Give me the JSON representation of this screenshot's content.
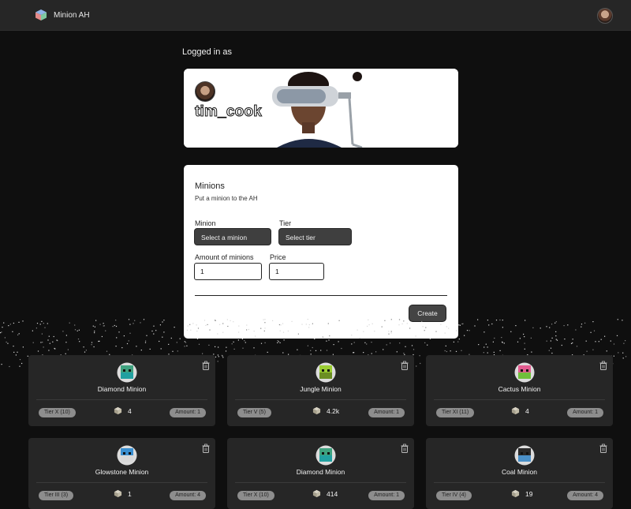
{
  "navbar": {
    "brand": "Minion AH",
    "logo_icon": "cube-logo-icon",
    "avatar_icon": "user-avatar-icon"
  },
  "profile": {
    "logged_in_label": "Logged in as",
    "username": "tim_cook"
  },
  "form": {
    "title": "Minions",
    "subtitle": "Put a minion to the AH",
    "minion_label": "Minion",
    "minion_placeholder": "Select a minion",
    "tier_label": "Tier",
    "tier_placeholder": "Select tier",
    "amount_label": "Amount of minions",
    "amount_value": "1",
    "price_label": "Price",
    "price_value": "1",
    "create_label": "Create"
  },
  "colors": {
    "background": "#0f0f0f",
    "card": "#262626",
    "pill": "#8d8d8d",
    "button": "#444444"
  },
  "minions": [
    {
      "name": "Diamond Minion",
      "tier": "Tier X (10)",
      "price": "4",
      "amount": "Amount: 1",
      "icon": "diamond-minion-icon",
      "top": "#3fa27f",
      "base": "#21a0a0"
    },
    {
      "name": "Jungle Minion",
      "tier": "Tier V (5)",
      "price": "4.2k",
      "amount": "Amount: 1",
      "icon": "jungle-minion-icon",
      "top": "#9acd32",
      "base": "#6b8e23"
    },
    {
      "name": "Cactus Minion",
      "tier": "Tier XI (11)",
      "price": "4",
      "amount": "Amount: 1",
      "icon": "cactus-minion-icon",
      "top": "#e25b8f",
      "base": "#6fbf3a"
    },
    {
      "name": "Glowstone Minion",
      "tier": "Tier III (3)",
      "price": "1",
      "amount": "Amount: 4",
      "icon": "glowstone-minion-icon",
      "top": "#3a8fd0",
      "base": "#d8d8d8"
    },
    {
      "name": "Diamond Minion",
      "tier": "Tier X (10)",
      "price": "414",
      "amount": "Amount: 1",
      "icon": "diamond-minion-icon",
      "top": "#3fa27f",
      "base": "#21a0a0"
    },
    {
      "name": "Coal Minion",
      "tier": "Tier IV (4)",
      "price": "19",
      "amount": "Amount: 4",
      "icon": "coal-minion-icon",
      "top": "#2a2a2a",
      "base": "#4a90c8"
    }
  ]
}
